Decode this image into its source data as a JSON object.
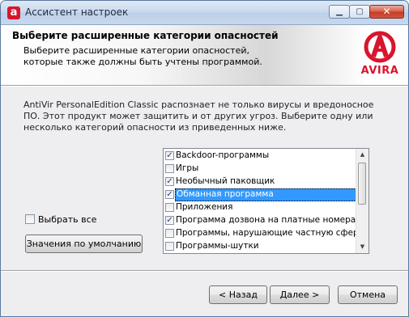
{
  "window": {
    "title": "Ассистент настроек",
    "app_icon": "avira-umbrella-icon"
  },
  "titlebar_buttons": {
    "minimize": "minimize-icon",
    "maximize": "maximize-icon",
    "close": "close-icon"
  },
  "header": {
    "title": "Выберите расширенные категории опасностей",
    "subtitle": "Выберите расширенные категории опасностей, которые также должны быть учтены программой.",
    "logo_text": "AVIRA",
    "brand_color": "#d7162e"
  },
  "description": "AntiVir PersonalEdition Classic распознает не только вирусы и вредоносное ПО. Этот продукт может защитить и от других угроз. Выберите одну или несколько категорий опасности из приведенных ниже.",
  "categories": [
    {
      "label": "Backdoor-программы",
      "checked": true
    },
    {
      "label": "Игры",
      "checked": false
    },
    {
      "label": "Необычный паковщик",
      "checked": true
    },
    {
      "label": "Обманная программа",
      "checked": true,
      "selected": true
    },
    {
      "label": "Приложения",
      "checked": false
    },
    {
      "label": "Программа дозвона на платные номера",
      "checked": true
    },
    {
      "label": "Программы, нарушающие частную сферу",
      "checked": false
    },
    {
      "label": "Программы-шутки",
      "checked": false
    }
  ],
  "select_all": {
    "label": "Выбрать все",
    "checked": false
  },
  "buttons": {
    "defaults": "Значения по умолчанию",
    "back": "< Назад",
    "next": "Далее >",
    "cancel": "Отмена"
  }
}
